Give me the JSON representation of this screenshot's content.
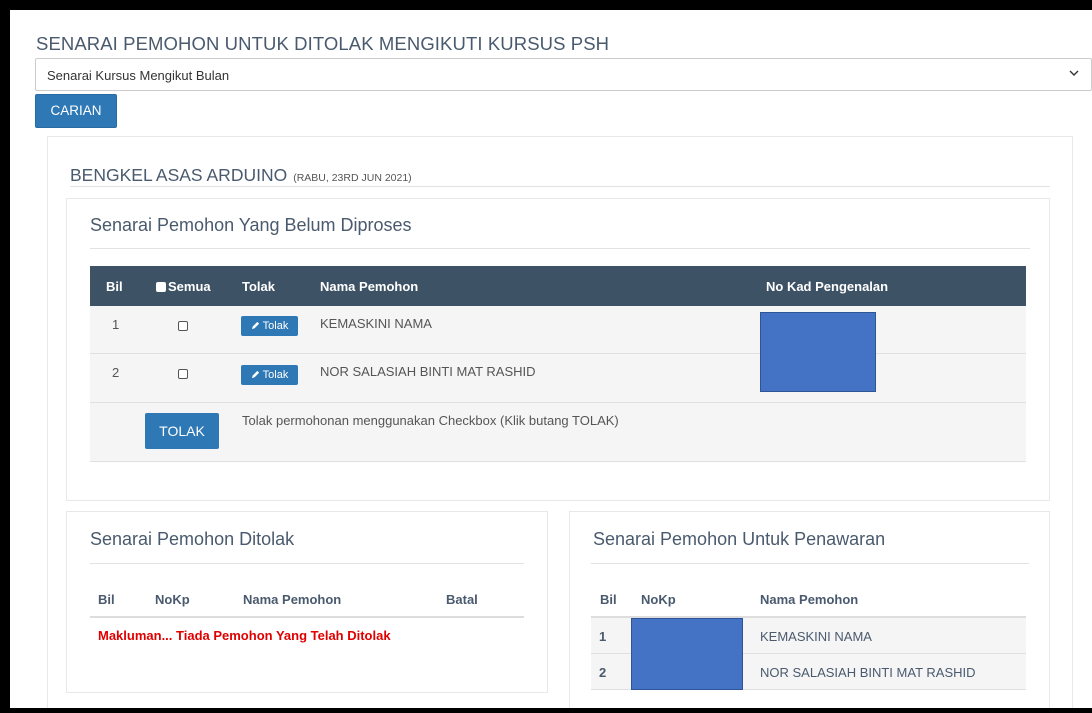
{
  "page": {
    "title": "SENARAI PEMOHON UNTUK DITOLAK MENGIKUTI KURSUS PSH",
    "select_value": "Senarai Kursus Mengikut Bulan",
    "search_button": "CARIAN"
  },
  "course": {
    "name": "BENGKEL ASAS ARDUINO",
    "date": "(RABU, 23RD JUN 2021)"
  },
  "pending": {
    "title": "Senarai Pemohon Yang Belum Diproses",
    "columns": [
      "Bil",
      "Semua",
      "Tolak",
      "Nama Pemohon",
      "No Kad Pengenalan"
    ],
    "rows": [
      {
        "bil": "1",
        "tolak_label": "Tolak",
        "nama": "KEMASKINI NAMA"
      },
      {
        "bil": "2",
        "tolak_label": "Tolak",
        "nama": "NOR SALASIAH BINTI MAT RASHID"
      }
    ],
    "bulk_button": "TOLAK",
    "bulk_help": "Tolak permohonan menggunakan Checkbox (Klik butang TOLAK)"
  },
  "rejected": {
    "title": "Senarai Pemohon Ditolak",
    "columns": [
      "Bil",
      "NoKp",
      "Nama Pemohon",
      "Batal"
    ],
    "empty_message": "Makluman... Tiada Pemohon Yang Telah Ditolak"
  },
  "offer": {
    "title": "Senarai Pemohon Untuk Penawaran",
    "columns": [
      "Bil",
      "NoKp",
      "Nama Pemohon"
    ],
    "rows": [
      {
        "bil": "1",
        "nama": "KEMASKINI NAMA"
      },
      {
        "bil": "2",
        "nama": "NOR SALASIAH BINTI MAT RASHID"
      }
    ]
  },
  "colors": {
    "header_bg": "#3e5266",
    "button_blue": "#2f78b6",
    "redaction_blue": "#4472c4",
    "alert_red": "#e00000"
  },
  "icons": {
    "select": "chevron-down-icon",
    "tolak": "pencil-icon"
  }
}
